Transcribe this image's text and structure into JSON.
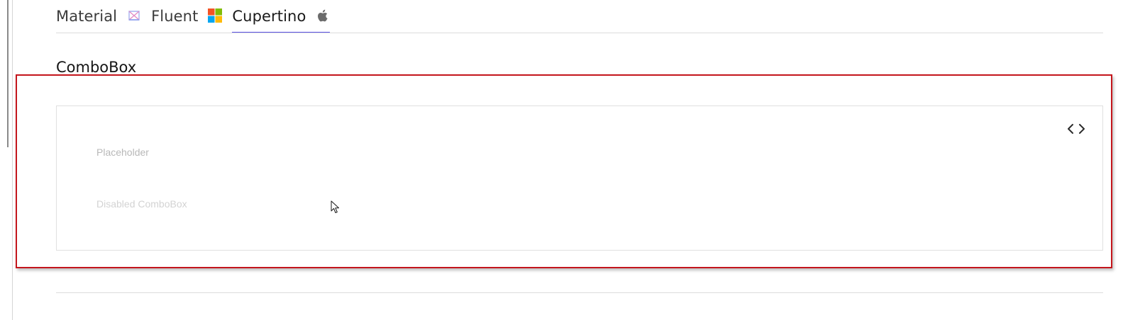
{
  "tabs": [
    {
      "label": "Material",
      "icon": "material-icon",
      "active": false
    },
    {
      "label": "Fluent",
      "icon": "windows-logo-icon",
      "active": false
    },
    {
      "label": "Cupertino",
      "icon": "apple-logo-icon",
      "active": true
    }
  ],
  "section": {
    "title": "ComboBox"
  },
  "demo": {
    "code_toggle_icon": "code-icon",
    "combo_placeholder": "Placeholder",
    "combo_disabled": "Disabled ComboBox"
  },
  "colors": {
    "accent": "#5b52e6",
    "highlight_border": "#c4161c"
  }
}
